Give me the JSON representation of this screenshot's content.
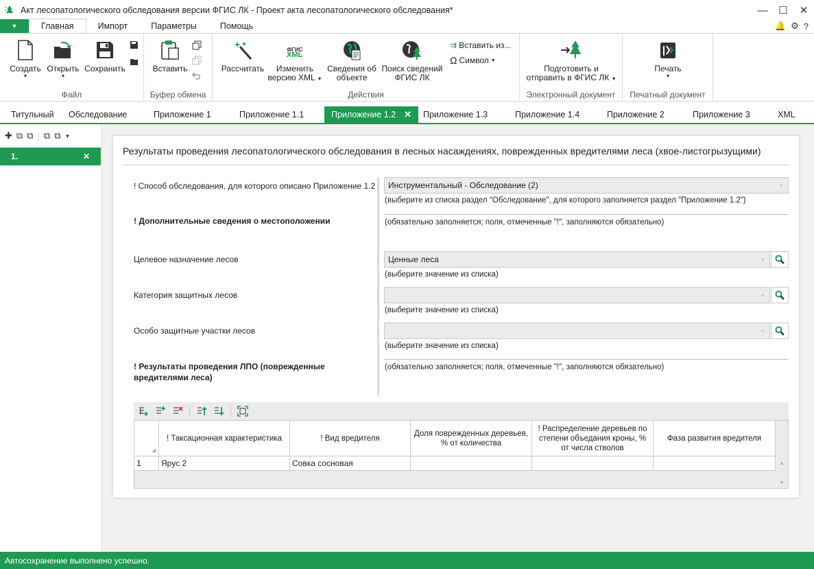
{
  "window": {
    "title": "Акт лесопатологического обследования версии ФГИС ЛК - Проект акта лесопатологического обследования*"
  },
  "ribbon_tabs": [
    "Главная",
    "Импорт",
    "Параметры",
    "Помощь"
  ],
  "ribbon": {
    "file_group": {
      "label": "Файл",
      "create": "Создать",
      "open": "Открыть",
      "save": "Сохранить"
    },
    "clipboard_group": {
      "label": "Буфер обмена",
      "paste": "Вставить"
    },
    "actions_group": {
      "label": "Действия",
      "calculate": "Рассчитать",
      "change_xml_1": "Изменить",
      "change_xml_2": "версию XML",
      "xml_badge_top": "ФГИС",
      "xml_badge_bottom": "XML",
      "object_info_1": "Сведения об",
      "object_info_2": "объекте",
      "search_1": "Поиск сведений",
      "search_2": "ФГИС ЛК",
      "insert_from": "Вставить из...",
      "symbol": "Символ"
    },
    "edoc_group": {
      "label": "Электронный документ",
      "prepare_1": "Подготовить и",
      "prepare_2": "отправить в ФГИС ЛК"
    },
    "print_group": {
      "label": "Печатный документ",
      "print": "Печать"
    }
  },
  "doc_tabs": [
    "Титульный",
    "Обследование",
    "Приложение 1",
    "Приложение 1.1",
    "Приложение 1.2",
    "Приложение 1.3",
    "Приложение 1.4",
    "Приложение 2",
    "Приложение 3",
    "XML"
  ],
  "left_panel": {
    "item": "1."
  },
  "form": {
    "heading": "Результаты проведения лесопатологического обследования в лесных насаждениях, поврежденных вредителями леса (хвое-листогрызущими)",
    "survey_method_label": "! Способ обследования, для которого описано Приложение 1.2",
    "survey_method_value": "Инструментальный - Обследование (2)",
    "survey_method_hint": "(выберите из списка раздел \"Обследование\", для которого заполняется раздел \"Приложение 1.2\")",
    "extra_location_label": "! Дополнительные сведения о местоположении",
    "extra_location_hint": "(обязательно заполняется; поля, отмеченные \"!\", заполняются обязательно)",
    "forest_purpose_label": "Целевое назначение лесов",
    "forest_purpose_value": "Ценные леса",
    "forest_purpose_hint": "(выберите значение из списка)",
    "protective_category_label": "Категория защитных лесов",
    "protective_category_value": "",
    "protective_category_hint": "(выберите значение из списка)",
    "special_areas_label": "Особо защитные участки лесов",
    "special_areas_value": "",
    "special_areas_hint": "(выберите значение из списка)",
    "results_label_1": "! Результаты проведения ЛПО (поврежденные",
    "results_label_2": "вредителями леса)",
    "results_hint": "(обязательно заполняется; поля, отмеченные \"!\", заполняются обязательно)"
  },
  "grid": {
    "columns": [
      "! Таксационная характеристика",
      "! Вид вредителя",
      "Доля поврежденных деревьев, % от количества",
      "! Распределение деревьев по степени объедания кроны, % от числа стволов",
      "Фаза развития вредителя"
    ],
    "rows": [
      {
        "num": "1",
        "cells": [
          "Ярус 2",
          "Совка сосновая",
          "",
          "",
          ""
        ]
      }
    ]
  },
  "status": "Автосохранение выполнено успешно.",
  "colors": {
    "accent": "#1e9a52"
  }
}
